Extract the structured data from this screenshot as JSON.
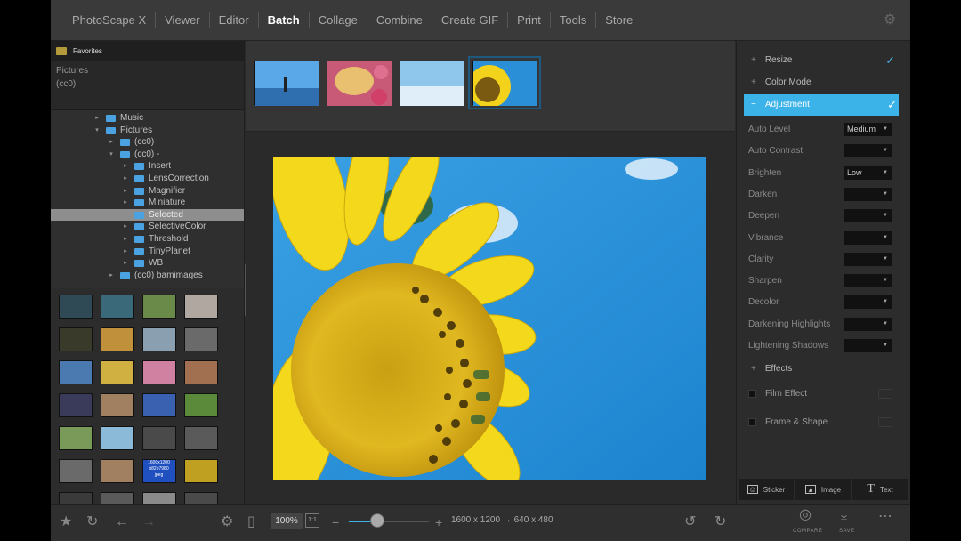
{
  "app": {
    "title": "PhotoScape X"
  },
  "menu": {
    "items": [
      {
        "label": "PhotoScape X"
      },
      {
        "label": "Viewer"
      },
      {
        "label": "Editor"
      },
      {
        "label": "Batch"
      },
      {
        "label": "Collage"
      },
      {
        "label": "Combine"
      },
      {
        "label": "Create GIF"
      },
      {
        "label": "Print"
      },
      {
        "label": "Tools"
      },
      {
        "label": "Store"
      }
    ],
    "active": "Batch"
  },
  "sidebar": {
    "favorites_label": "Favorites",
    "recent": [
      "Pictures",
      "(cc0)"
    ],
    "tree": [
      {
        "label": "Music",
        "depth": 0,
        "arrow": "▸"
      },
      {
        "label": "Pictures",
        "depth": 0,
        "arrow": "▾"
      },
      {
        "label": "(cc0)",
        "depth": 1,
        "arrow": "▸"
      },
      {
        "label": "(cc0) -",
        "depth": 1,
        "arrow": "▾"
      },
      {
        "label": "Insert",
        "depth": 2,
        "arrow": "▸"
      },
      {
        "label": "LensCorrection",
        "depth": 2,
        "arrow": "▸"
      },
      {
        "label": "Magnifier",
        "depth": 2,
        "arrow": "▸"
      },
      {
        "label": "Miniature",
        "depth": 2,
        "arrow": "▸"
      },
      {
        "label": "Selected",
        "depth": 2,
        "arrow": "",
        "selected": true
      },
      {
        "label": "SelectiveColor",
        "depth": 2,
        "arrow": "▸"
      },
      {
        "label": "Threshold",
        "depth": 2,
        "arrow": "▸"
      },
      {
        "label": "TinyPlanet",
        "depth": 2,
        "arrow": "▸"
      },
      {
        "label": "WB",
        "depth": 2,
        "arrow": "▸"
      },
      {
        "label": "(cc0) bamimages",
        "depth": 1,
        "arrow": "▸"
      }
    ],
    "thumb_colors": [
      "#2f4a55",
      "#3a6a7a",
      "#6a8a4a",
      "#b0a8a0",
      "#3a3a2a",
      "#c0903a",
      "#8aa0b0",
      "#6a6a6a",
      "#4a7ab0",
      "#d0b040",
      "#d080a0",
      "#a07050",
      "#3a3a5a",
      "#a08060",
      "#3a60b0",
      "#5a8a3a",
      "#7a9a5a",
      "#8abad8",
      "#4a4a4a",
      "#5a5a5a",
      "#6a6a6a",
      "#a08060",
      "#2050c0",
      "#c0a020",
      "#3a3a3a",
      "#5a5a5a",
      "#8a8a8a",
      "#4a4a4a"
    ],
    "thumb_label": "1600x1200\nb82e7980\njpeg"
  },
  "filmstrip": {
    "thumbs": [
      {
        "name": "beach-thumb"
      },
      {
        "name": "flowers-thumb"
      },
      {
        "name": "sky-thumb"
      },
      {
        "name": "sunflower-thumb",
        "selected": true
      }
    ]
  },
  "adjustments": {
    "sections": {
      "resize": "Resize",
      "color_mode": "Color Mode",
      "adjustment": "Adjustment",
      "effects": "Effects"
    },
    "rows": [
      {
        "label": "Auto Level",
        "value": "Medium"
      },
      {
        "label": "Auto Contrast",
        "value": ""
      },
      {
        "label": "Brighten",
        "value": "Low"
      },
      {
        "label": "Darken",
        "value": ""
      },
      {
        "label": "Deepen",
        "value": ""
      },
      {
        "label": "Vibrance",
        "value": ""
      },
      {
        "label": "Clarity",
        "value": ""
      },
      {
        "label": "Sharpen",
        "value": ""
      },
      {
        "label": "Decolor",
        "value": ""
      },
      {
        "label": "Darkening Highlights",
        "value": ""
      },
      {
        "label": "Lightening Shadows",
        "value": ""
      }
    ],
    "checks": [
      {
        "label": "Film Effect"
      },
      {
        "label": "Frame & Shape"
      }
    ],
    "tools": {
      "sticker": "Sticker",
      "image": "Image",
      "text": "Text"
    }
  },
  "bottom": {
    "zoom": "100%",
    "zoom_1to1": "1:1",
    "zoom_level": 0.35,
    "size_text": "1600 x 1200 → 640 x 480",
    "compare": "COMPARE",
    "save": "SAVE"
  },
  "colors": {
    "accent": "#3bb2e8",
    "sky": "#1e8fd6",
    "sunflower": "#f2d21a"
  }
}
